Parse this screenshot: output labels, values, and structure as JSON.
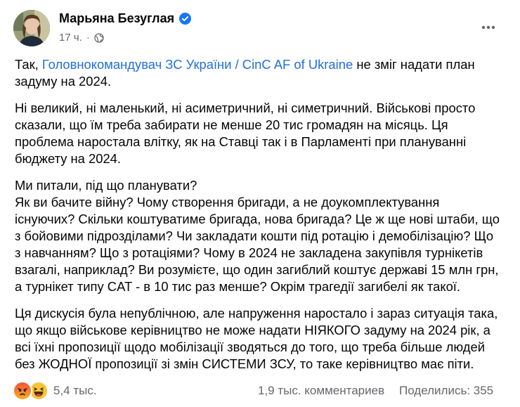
{
  "post": {
    "author": "Марьяна Безуглая",
    "time": "17 ч.",
    "separator": "·",
    "icons": {
      "verified": "verified-badge-icon",
      "privacy": "globe-icon",
      "more": "more-options-icon"
    },
    "accent_color": "#1877f2",
    "link_color": "#216fdb"
  },
  "content": {
    "p1": {
      "l1_pre": "Так, ",
      "l1_link": "Головнокомандувач ЗС України / CinC AF of Ukraine",
      "l1_post": " не зміг надати план",
      "l2": "задуму на 2024."
    },
    "p2": [
      "Ні великий, ні маленький, ні асиметричний, ні симетричний. Військові просто",
      "сказали, що їм треба забирати не менше 20 тис громадян на місяць. Ця",
      "проблема наростала влітку, як на Ставці так і в Парламенті при плануванні",
      "бюджету на 2024."
    ],
    "p3": [
      "Ми питали, під що планувати?",
      "Як ви бачите війну? Чому створення бригади, а не доукомплектування",
      "існуючих? Скільки коштуватиме бригада, нова бригада? Це ж ще нові штаби, що",
      "з бойовими підрозділами? Чи закладати кошти під ротацію і демобілізацію? Що",
      "з навчанням? Що з ротаціями? Чому в 2024 не закладена закупівля турнікетів",
      "взагалі, наприклад? Ви розумієте, що один загиблий коштує державі 15 млн грн,",
      "а турнікет типу CAT - в 10 тис раз менше? Окрім трагедії загибелі як такої."
    ],
    "p4": [
      "Ця дискусія була непублічною, але напруження наростало і зараз ситуація така,",
      "що якщо військове керівництво не може надати НІЯКОГО задуму на 2024 рік, а",
      "всі їхні пропозиції щодо мобілізації зводяться до того, що треба більше людей",
      "без ЖОДНОЇ пропозиції зі змін СИСТЕМИ ЗСУ, то таке керівництво має піти."
    ]
  },
  "footer": {
    "reactions": [
      "angry-reaction-icon",
      "haha-reaction-icon"
    ],
    "reaction_count": "5,4 тыс.",
    "comments": "1,9 тыс. комментариев",
    "shares": "Поделились: 355"
  }
}
